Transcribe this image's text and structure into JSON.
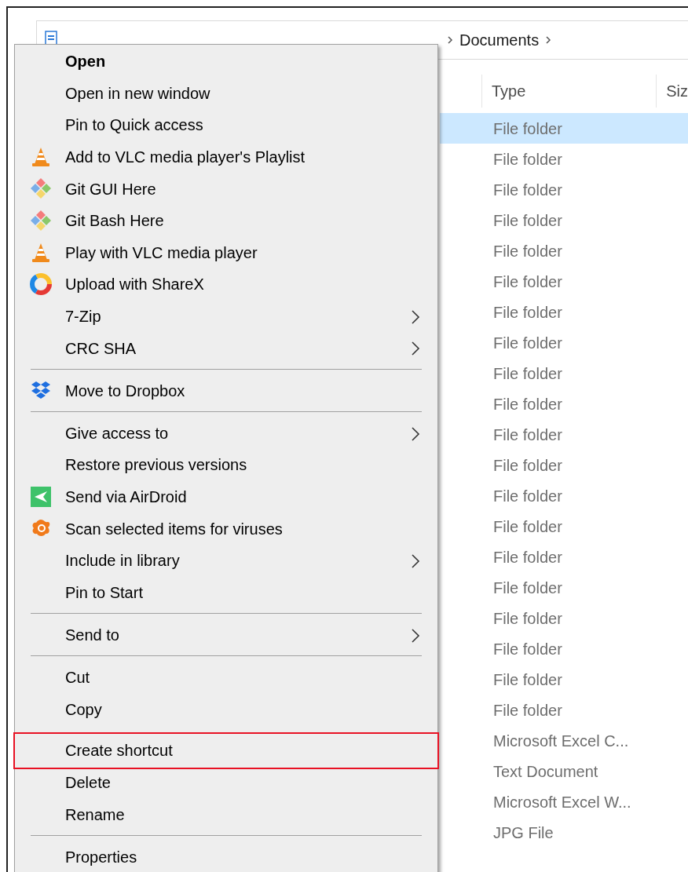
{
  "address_bar": {
    "crumbs": [
      "Documents"
    ]
  },
  "columns": [
    "Type",
    "Siz"
  ],
  "rows": [
    {
      "type": "File folder",
      "selected": true
    },
    {
      "type": "File folder",
      "selected": false
    },
    {
      "type": "File folder",
      "selected": false
    },
    {
      "type": "File folder",
      "selected": false
    },
    {
      "type": "File folder",
      "selected": false
    },
    {
      "type": "File folder",
      "selected": false
    },
    {
      "type": "File folder",
      "selected": false
    },
    {
      "type": "File folder",
      "selected": false
    },
    {
      "type": "File folder",
      "selected": false
    },
    {
      "type": "File folder",
      "selected": false
    },
    {
      "type": "File folder",
      "selected": false
    },
    {
      "type": "File folder",
      "selected": false
    },
    {
      "type": "File folder",
      "selected": false
    },
    {
      "type": "File folder",
      "selected": false
    },
    {
      "type": "File folder",
      "selected": false
    },
    {
      "type": "File folder",
      "selected": false
    },
    {
      "type": "File folder",
      "selected": false
    },
    {
      "type": "File folder",
      "selected": false
    },
    {
      "type": "File folder",
      "selected": false
    },
    {
      "type": "File folder",
      "selected": false
    },
    {
      "type": "Microsoft Excel C...",
      "selected": false
    },
    {
      "type": "Text Document",
      "selected": false
    },
    {
      "type": "Microsoft Excel W...",
      "selected": false
    },
    {
      "type": "JPG File",
      "selected": false
    }
  ],
  "context_menu": {
    "items": [
      {
        "kind": "plain",
        "label": "Open",
        "default": true
      },
      {
        "kind": "plain",
        "label": "Open in new window"
      },
      {
        "kind": "plain",
        "label": "Pin to Quick access"
      },
      {
        "kind": "vlc",
        "label": "Add to VLC media player's Playlist"
      },
      {
        "kind": "git",
        "label": "Git GUI Here"
      },
      {
        "kind": "git",
        "label": "Git Bash Here"
      },
      {
        "kind": "vlc",
        "label": "Play with VLC media player"
      },
      {
        "kind": "sharex",
        "label": "Upload with ShareX"
      },
      {
        "kind": "plain",
        "label": "7-Zip",
        "submenu": true
      },
      {
        "kind": "plain",
        "label": "CRC SHA",
        "submenu": true
      },
      {
        "kind": "separator"
      },
      {
        "kind": "dropbox",
        "label": "Move to Dropbox"
      },
      {
        "kind": "separator"
      },
      {
        "kind": "plain",
        "label": "Give access to",
        "submenu": true
      },
      {
        "kind": "plain",
        "label": "Restore previous versions"
      },
      {
        "kind": "airdroid",
        "label": "Send via AirDroid"
      },
      {
        "kind": "avast",
        "label": "Scan selected items for viruses"
      },
      {
        "kind": "plain",
        "label": "Include in library",
        "submenu": true
      },
      {
        "kind": "plain",
        "label": "Pin to Start"
      },
      {
        "kind": "separator"
      },
      {
        "kind": "plain",
        "label": "Send to",
        "submenu": true
      },
      {
        "kind": "separator"
      },
      {
        "kind": "plain",
        "label": "Cut"
      },
      {
        "kind": "plain",
        "label": "Copy"
      },
      {
        "kind": "plain",
        "label": "Create shortcut",
        "outlined": true
      },
      {
        "kind": "plain",
        "label": "Delete"
      },
      {
        "kind": "plain",
        "label": "Rename"
      },
      {
        "kind": "separator"
      },
      {
        "kind": "plain",
        "label": "Properties"
      }
    ]
  }
}
